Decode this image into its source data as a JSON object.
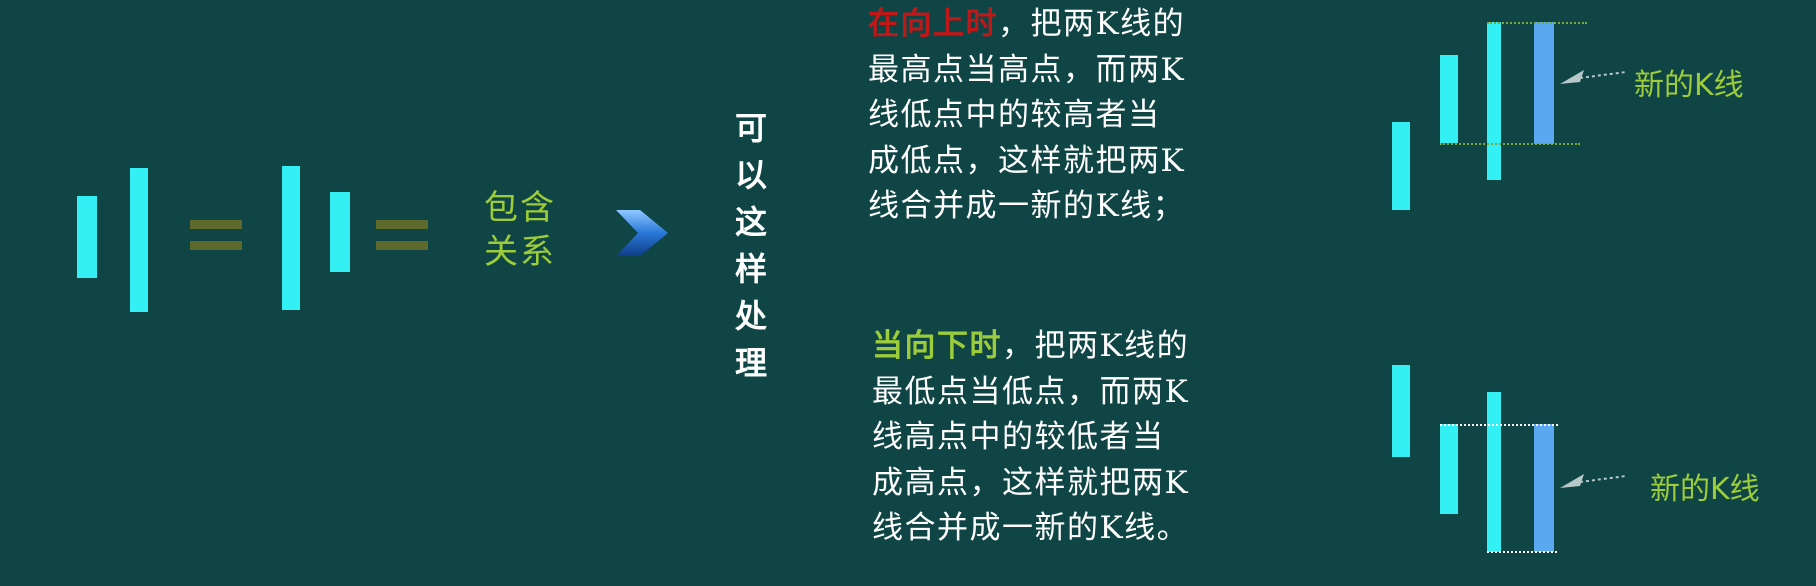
{
  "colors": {
    "background": "#0f4545",
    "kline_bar": "#33f0f5",
    "merged_bar": "#5aa8f0",
    "red_heading": "#c01818",
    "green_heading": "#9ccc3a",
    "equals": "#5e6a2c"
  },
  "left_figure": {
    "relation_line1": "包含",
    "relation_line2": "关系",
    "arrow_icon": "chevron-right-icon"
  },
  "vertical_text": "可以这样处理",
  "rule_up": {
    "heading": "在向上时",
    "line1_rest": "，把两K线的",
    "line2": "最高点当高点，而两K",
    "line3": "线低点中的较高者当",
    "line4": "成低点，这样就把两K",
    "line5": "线合并成一新的K线；"
  },
  "rule_down": {
    "heading": "当向下时",
    "line1_rest": "，把两K线的",
    "line2": "最低点当低点，而两K",
    "line3": "线高点中的较低者当",
    "line4": "成高点，这样就把两K",
    "line5": "线合并成一新的K线。"
  },
  "figure_up": {
    "new_k_label": "新的K线"
  },
  "figure_down": {
    "new_k_label": "新的K线"
  }
}
